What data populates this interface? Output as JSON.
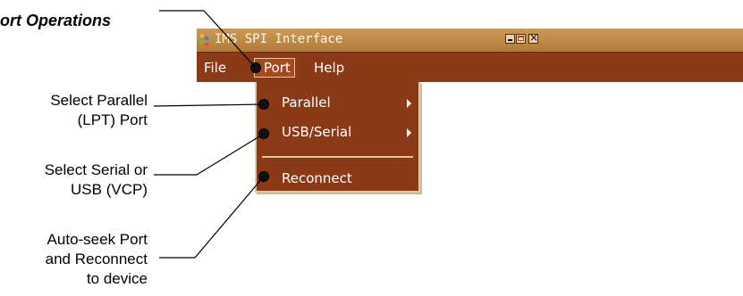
{
  "callouts": {
    "port_operations": "ort Operations",
    "parallel": [
      "Select Parallel",
      "(LPT) Port"
    ],
    "serial": [
      "Select Serial or",
      "USB (VCP)"
    ],
    "reconnect": [
      "Auto-seek Port",
      "and Reconnect",
      "to device"
    ]
  },
  "window": {
    "title": "IMS SPI Interface",
    "icon": "app-icon",
    "buttons": [
      "minimize-icon",
      "maximize-icon",
      "close-icon"
    ]
  },
  "menubar": {
    "items": [
      {
        "label": "File"
      },
      {
        "label": "Port",
        "active": true
      },
      {
        "label": "Help"
      }
    ]
  },
  "port_menu": {
    "items": [
      {
        "label": "Parallel",
        "submenu": true
      },
      {
        "label": "USB/Serial",
        "submenu": true
      },
      {
        "label": "Reconnect",
        "submenu": false
      }
    ]
  },
  "colors": {
    "menu_bg": "#8b3a17",
    "titlebar": "#cc9a56",
    "menu_border": "#e9c79e",
    "text": "#ffffff"
  }
}
